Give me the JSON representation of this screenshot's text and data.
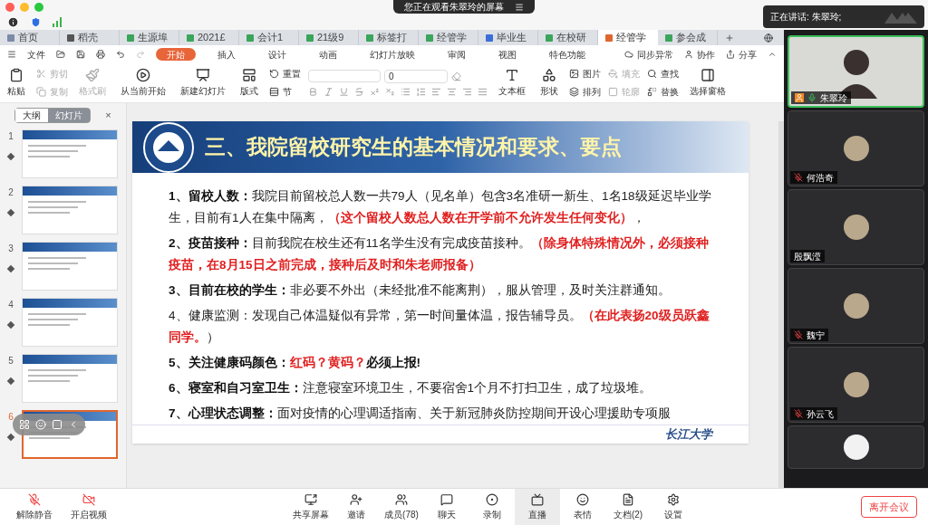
{
  "banner": {
    "text": "您正在观看朱翠玲的屏幕"
  },
  "speaking": {
    "text": "正在讲话: 朱翠玲;"
  },
  "doc_tabs": [
    {
      "label": "首页",
      "kind": "home",
      "selected": false
    },
    {
      "label": "稻壳",
      "kind": "docer",
      "selected": false
    },
    {
      "label": "生源埠",
      "kind": "sheet",
      "selected": false
    },
    {
      "label": "2021£",
      "kind": "sheet",
      "selected": false
    },
    {
      "label": "会计1",
      "kind": "sheet",
      "selected": false
    },
    {
      "label": "21级9",
      "kind": "sheet",
      "selected": false
    },
    {
      "label": "标签打",
      "kind": "sheet",
      "selected": false
    },
    {
      "label": "经管学",
      "kind": "sheet",
      "selected": false
    },
    {
      "label": "毕业生",
      "kind": "doc",
      "selected": false
    },
    {
      "label": "在校研",
      "kind": "sheet",
      "selected": false
    },
    {
      "label": "经管学",
      "kind": "slides",
      "selected": true
    },
    {
      "label": "参会成",
      "kind": "sheet",
      "selected": false
    }
  ],
  "menu": {
    "file": "文件",
    "tabs": [
      {
        "label": "开始",
        "selected": true
      },
      {
        "label": "插入",
        "selected": false
      },
      {
        "label": "设计",
        "selected": false
      },
      {
        "label": "动画",
        "selected": false
      },
      {
        "label": "幻灯片放映",
        "selected": false
      },
      {
        "label": "审阅",
        "selected": false
      },
      {
        "label": "视图",
        "selected": false
      },
      {
        "label": "特色功能",
        "selected": false
      }
    ],
    "right": [
      "同步异常",
      "协作",
      "分享"
    ]
  },
  "ribbon": [
    {
      "kind": "large",
      "items": [
        {
          "label": "粘贴",
          "disabled": false
        }
      ]
    },
    {
      "kind": "stack",
      "items": [
        {
          "label": "剪切",
          "disabled": true
        },
        {
          "label": "复制",
          "disabled": true
        }
      ]
    },
    {
      "kind": "large",
      "items": [
        {
          "label": "格式刷",
          "disabled": true
        }
      ]
    },
    {
      "kind": "large",
      "items": [
        {
          "label": "从当前开始",
          "disabled": false
        }
      ]
    },
    {
      "kind": "large",
      "items": [
        {
          "label": "新建幻灯片",
          "disabled": false
        }
      ]
    },
    {
      "kind": "large",
      "items": [
        {
          "label": "版式",
          "disabled": false
        }
      ]
    },
    {
      "kind": "stack",
      "items": [
        {
          "label": "重置",
          "disabled": false
        },
        {
          "label": "节",
          "disabled": false
        }
      ]
    },
    {
      "kind": "font",
      "size": "0"
    },
    {
      "kind": "large",
      "items": [
        {
          "label": "文本框",
          "disabled": false
        }
      ]
    },
    {
      "kind": "large",
      "items": [
        {
          "label": "形状",
          "disabled": false
        }
      ]
    },
    {
      "kind": "stack",
      "items": [
        {
          "label": "图片",
          "disabled": false
        },
        {
          "label": "排列",
          "disabled": false
        }
      ]
    },
    {
      "kind": "stack",
      "items": [
        {
          "label": "填充",
          "disabled": true
        },
        {
          "label": "轮廓",
          "disabled": true
        }
      ]
    },
    {
      "kind": "stack",
      "items": [
        {
          "label": "查找",
          "disabled": false
        },
        {
          "label": "替换",
          "disabled": false
        }
      ]
    },
    {
      "kind": "large",
      "items": [
        {
          "label": "选择窗格",
          "disabled": false
        }
      ]
    }
  ],
  "panel": {
    "tabs": [
      {
        "label": "大纲",
        "selected": false
      },
      {
        "label": "幻灯片",
        "selected": true
      }
    ],
    "close": "×",
    "thumbnails": [
      {
        "number": "1",
        "selected": false
      },
      {
        "number": "2",
        "selected": false
      },
      {
        "number": "3",
        "selected": false
      },
      {
        "number": "4",
        "selected": false
      },
      {
        "number": "5",
        "selected": false
      },
      {
        "number": "6",
        "selected": true
      }
    ]
  },
  "slide": {
    "title": "三、我院留校研究生的基本情况和要求、要点",
    "footer_logo": "长江大学",
    "items": [
      {
        "segments": [
          {
            "kind": "label",
            "text": "1、留校人数："
          },
          {
            "kind": "normal",
            "text": "我院目前留校总人数一共79人（见名单）包含3名准研一新生、1名18级延迟毕业学生，目前有1人在集中隔离，"
          },
          {
            "kind": "alert",
            "text": "（这个留校人数总人数在开学前不允许发生任何变化）"
          },
          {
            "kind": "normal",
            "text": "，"
          }
        ]
      },
      {
        "segments": [
          {
            "kind": "label",
            "text": "2、疫苗接种："
          },
          {
            "kind": "normal",
            "text": "目前我院在校生还有11名学生没有完成疫苗接种。"
          },
          {
            "kind": "alert",
            "text": "（除身体特殊情况外，必须接种疫苗，在8月15日之前完成，接种后及时和朱老师报备）"
          }
        ]
      },
      {
        "segments": [
          {
            "kind": "label",
            "text": "3、目前在校的学生："
          },
          {
            "kind": "normal",
            "text": "非必要不外出（未经批准不能离荆），服从管理，及时关注群通知。"
          }
        ]
      },
      {
        "segments": [
          {
            "kind": "normal",
            "text": "4、健康监测：发现自己体温疑似有异常，第一时间量体温，报告辅导员。"
          },
          {
            "kind": "alert",
            "text": "（在此表扬20级员跃鑫同学。"
          },
          {
            "kind": "normal",
            "text": "）"
          }
        ]
      },
      {
        "segments": [
          {
            "kind": "label",
            "text": "5、关注健康码颜色："
          },
          {
            "kind": "alert",
            "text": "红码？黄码？"
          },
          {
            "kind": "label",
            "text": "必须上报!"
          }
        ]
      },
      {
        "segments": [
          {
            "kind": "label",
            "text": "6、寝室和自习室卫生："
          },
          {
            "kind": "normal",
            "text": "注意寝室环境卫生，不要宿舍1个月不打扫卫生，成了垃圾堆。"
          }
        ]
      },
      {
        "segments": [
          {
            "kind": "label",
            "text": "7、心理状态调整："
          },
          {
            "kind": "normal",
            "text": "面对疫情的心理调适指南、关于新冠肺炎防控期间开设心理援助专项服"
          }
        ]
      }
    ]
  },
  "participants": [
    {
      "name": "朱翠玲",
      "kind": "video",
      "muted": false
    },
    {
      "name": "何浩奇",
      "kind": "avatar",
      "muted": true
    },
    {
      "name": "殷飘滢",
      "kind": "avatar",
      "muted": false
    },
    {
      "name": "魏宁",
      "kind": "avatar",
      "muted": true
    },
    {
      "name": "孙云飞",
      "kind": "avatar",
      "muted": true
    },
    {
      "kind": "partial"
    }
  ],
  "toolbar": {
    "left": [
      "解除静音",
      "开启视频"
    ],
    "center": [
      {
        "label": "共享屏幕",
        "selected": false
      },
      {
        "label": "邀请",
        "selected": false
      },
      {
        "label": "成员(78)",
        "selected": false
      },
      {
        "label": "聊天",
        "selected": false
      },
      {
        "label": "录制",
        "selected": false
      },
      {
        "label": "直播",
        "selected": true
      },
      {
        "label": "表情",
        "selected": false
      },
      {
        "label": "文档(2)",
        "selected": false
      },
      {
        "label": "设置",
        "selected": false
      }
    ],
    "leave": "离开会议"
  }
}
